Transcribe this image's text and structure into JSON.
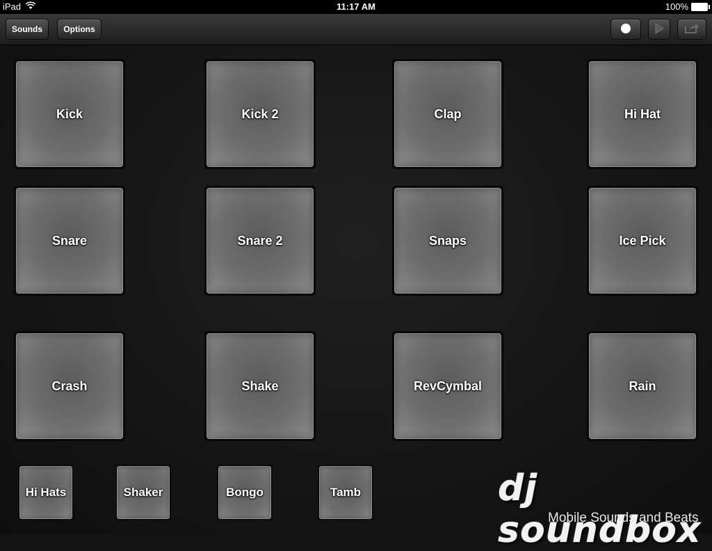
{
  "status_bar": {
    "device": "iPad",
    "time": "11:17 AM",
    "battery": "100%",
    "icons": [
      "wifi-icon",
      "battery-icon"
    ]
  },
  "toolbar": {
    "sounds_label": "Sounds",
    "options_label": "Options",
    "icons": [
      "record-icon",
      "play-icon",
      "share-icon"
    ]
  },
  "pads": [
    "Kick",
    "Kick 2",
    "Clap",
    "Hi Hat",
    "Snare",
    "Snare 2",
    "Snaps",
    "Ice Pick",
    "Crash",
    "Shake",
    "RevCymbal",
    "Rain"
  ],
  "mini_pads": [
    "Hi Hats",
    "Shaker",
    "Bongo",
    "Tamb"
  ],
  "brand": {
    "logo": "dj soundbox",
    "tagline": "Mobile Sounds and Beats"
  }
}
